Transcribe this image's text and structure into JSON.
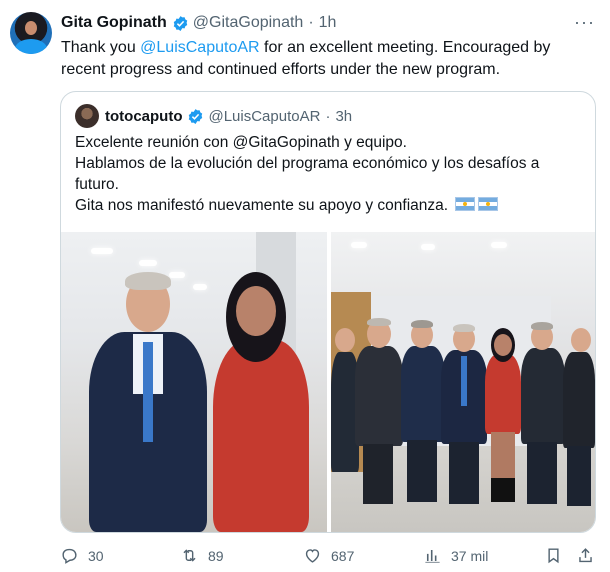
{
  "tweet": {
    "author_name": "Gita Gopinath",
    "author_handle": "@GitaGopinath",
    "separator": "·",
    "time": "1h",
    "more_label": "···",
    "text_before": "Thank you ",
    "text_mention": "@LuisCaputoAR",
    "text_after": " for an excellent meeting. Encouraged by recent progress and continued efforts under the new program."
  },
  "quote": {
    "author_name": "totocaputo",
    "author_handle": "@LuisCaputoAR",
    "separator": "·",
    "time": "3h",
    "lines": [
      "Excelente reunión con @GitaGopinath y equipo.",
      "Hablamos de la evolución del programa económico y los desafíos a",
      "futuro.",
      "Gita nos manifestó nuevamente su apoyo y confianza."
    ],
    "flags": [
      "argentina-flag-icon",
      "argentina-flag-icon"
    ]
  },
  "actions": {
    "replies": "30",
    "reposts": "89",
    "likes": "687",
    "views": "37 mil"
  },
  "colors": {
    "accent": "#1d9bf0",
    "text": "#0f1419",
    "muted": "#536471",
    "border": "#cfd9de"
  },
  "icons": [
    "verified-badge-icon",
    "more-icon",
    "reply-icon",
    "repost-icon",
    "like-icon",
    "views-icon",
    "bookmark-icon",
    "share-icon"
  ]
}
